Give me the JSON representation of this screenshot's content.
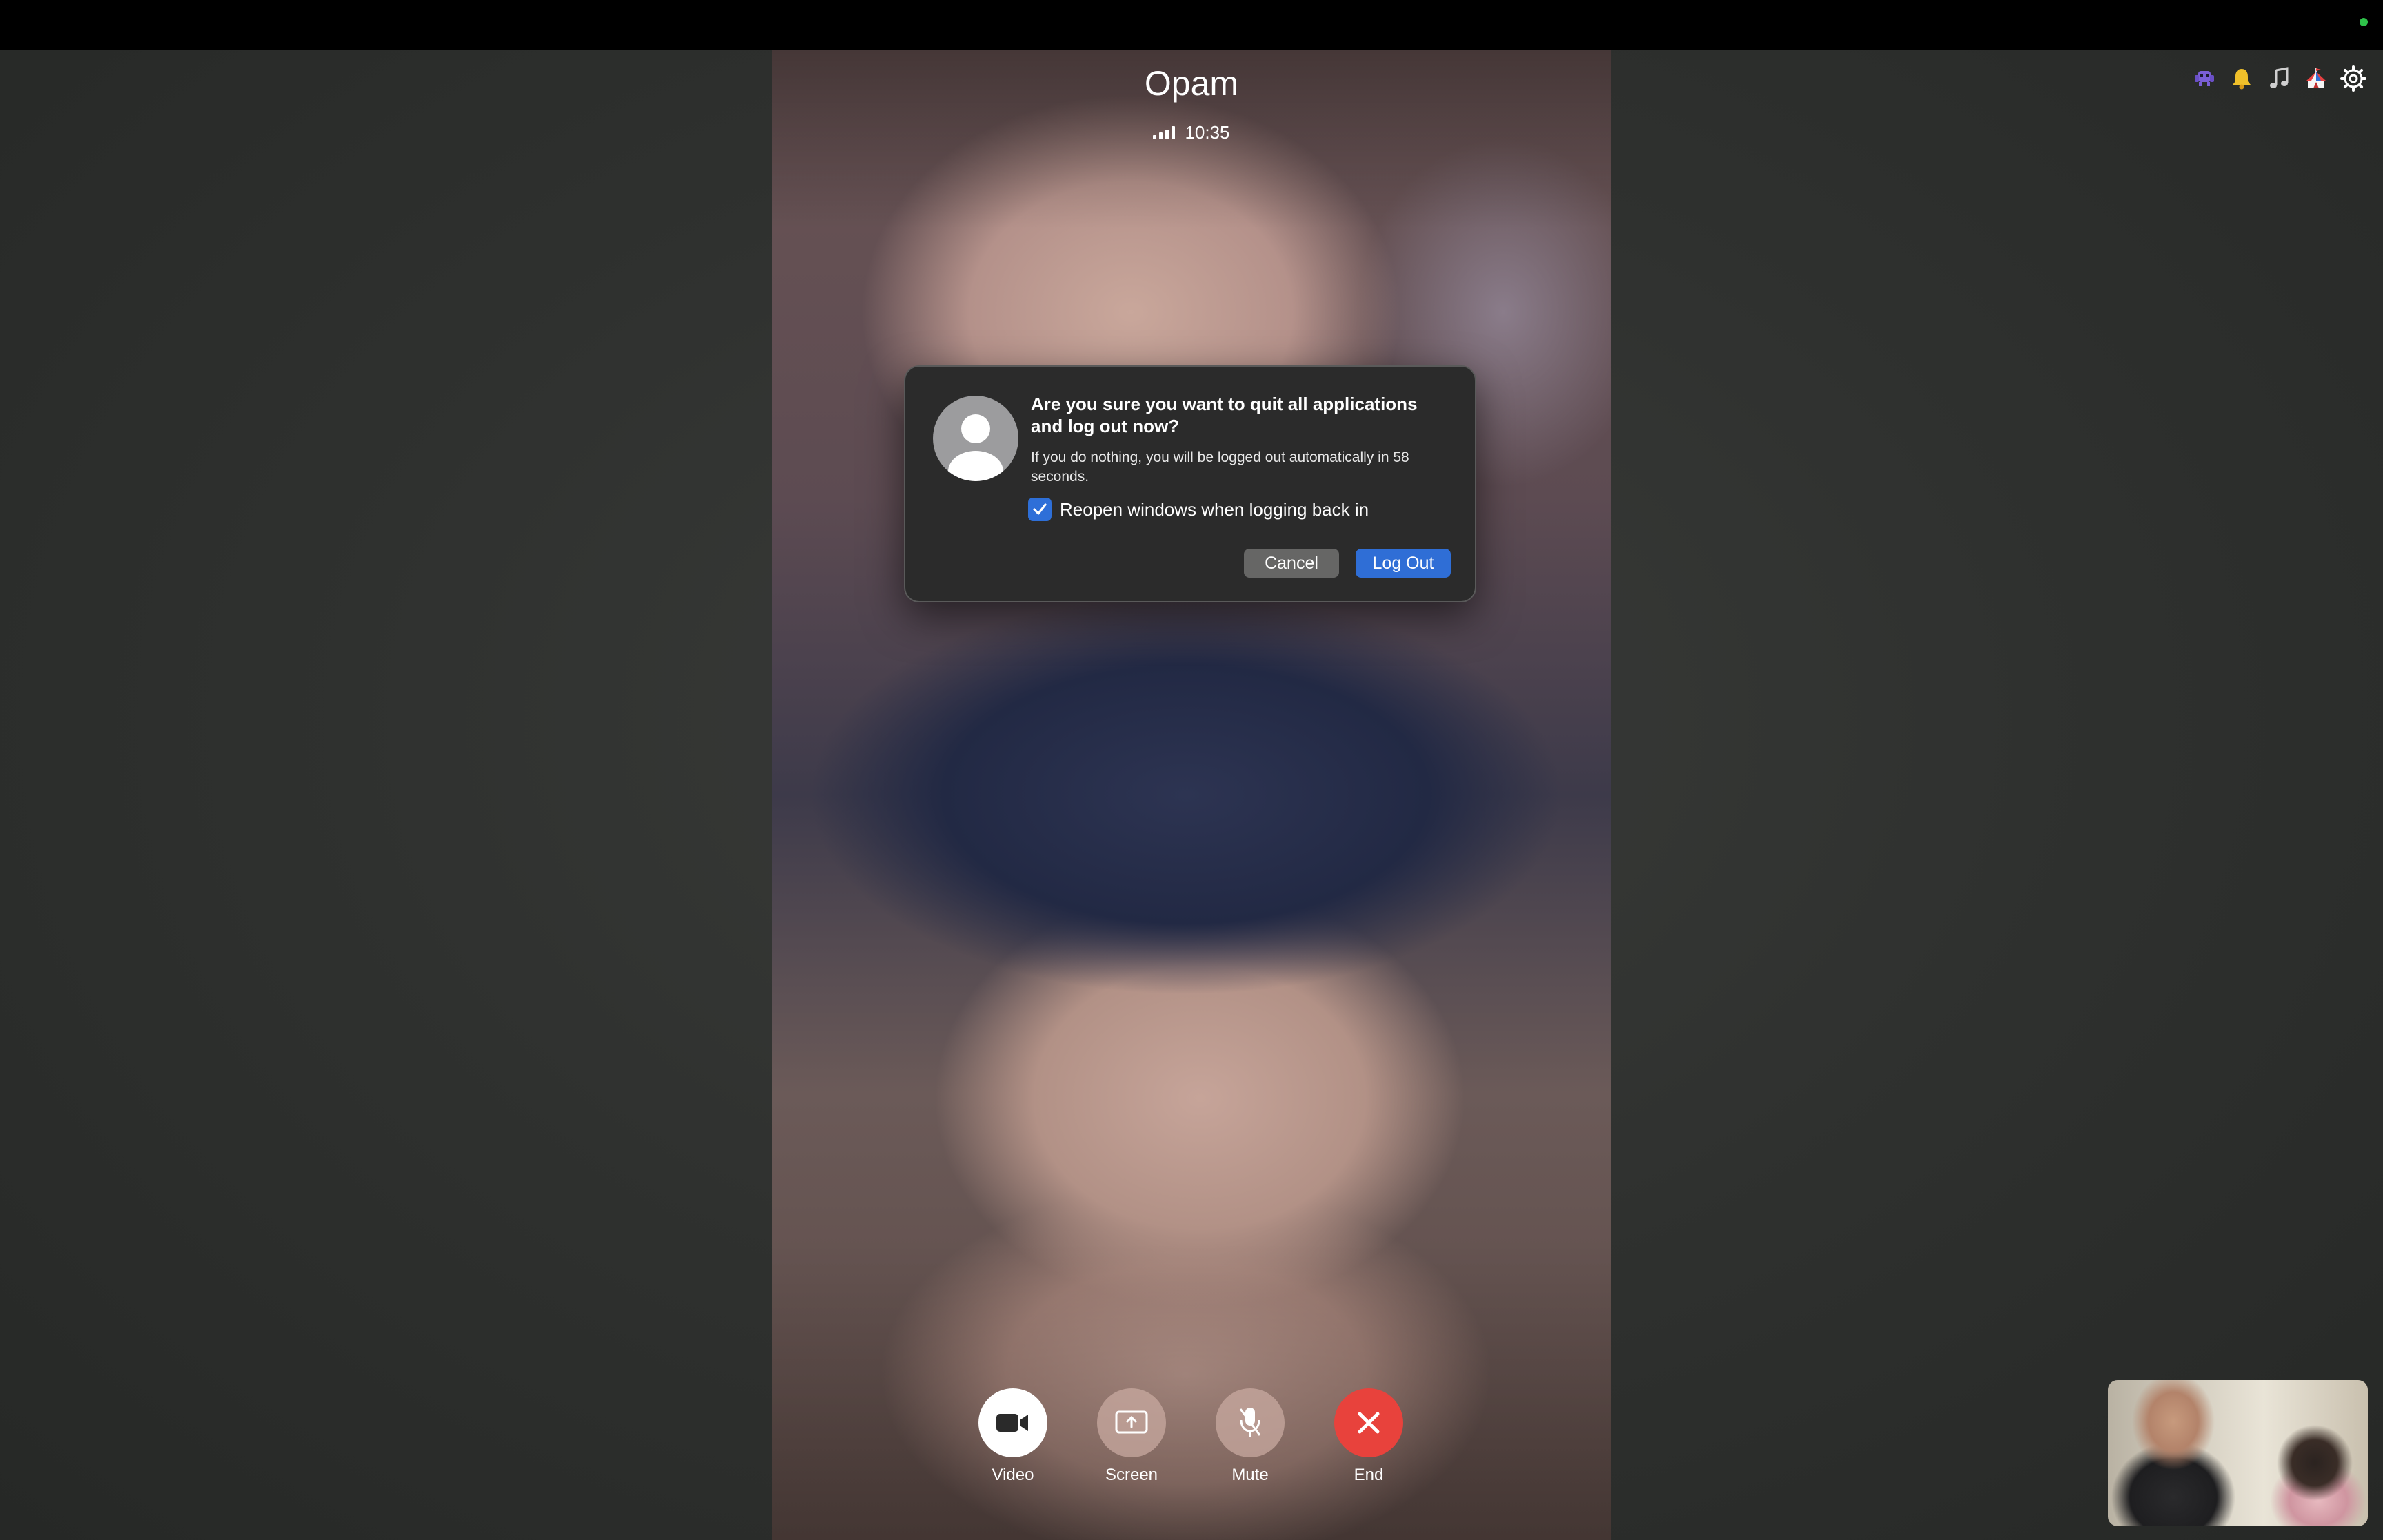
{
  "call": {
    "caller_name": "Opam",
    "duration": "10:35",
    "signal_bars": 4
  },
  "tray_icons": [
    "alien-icon",
    "bell-icon",
    "music-note-icon",
    "circus-tent-icon",
    "gear-icon"
  ],
  "dialog": {
    "title": "Are you sure you want to quit all applications and log out now?",
    "message": "If you do nothing, you will be logged out automatically in 58 seconds.",
    "checkbox_label": "Reopen windows when logging back in",
    "checkbox_checked": true,
    "cancel_label": "Cancel",
    "logout_label": "Log Out"
  },
  "controls": {
    "video_label": "Video",
    "screen_label": "Screen",
    "mute_label": "Mute",
    "end_label": "End"
  },
  "colors": {
    "accent_blue": "#2f6ed6",
    "end_red": "#e8423c",
    "status_green": "#2fc24a"
  }
}
